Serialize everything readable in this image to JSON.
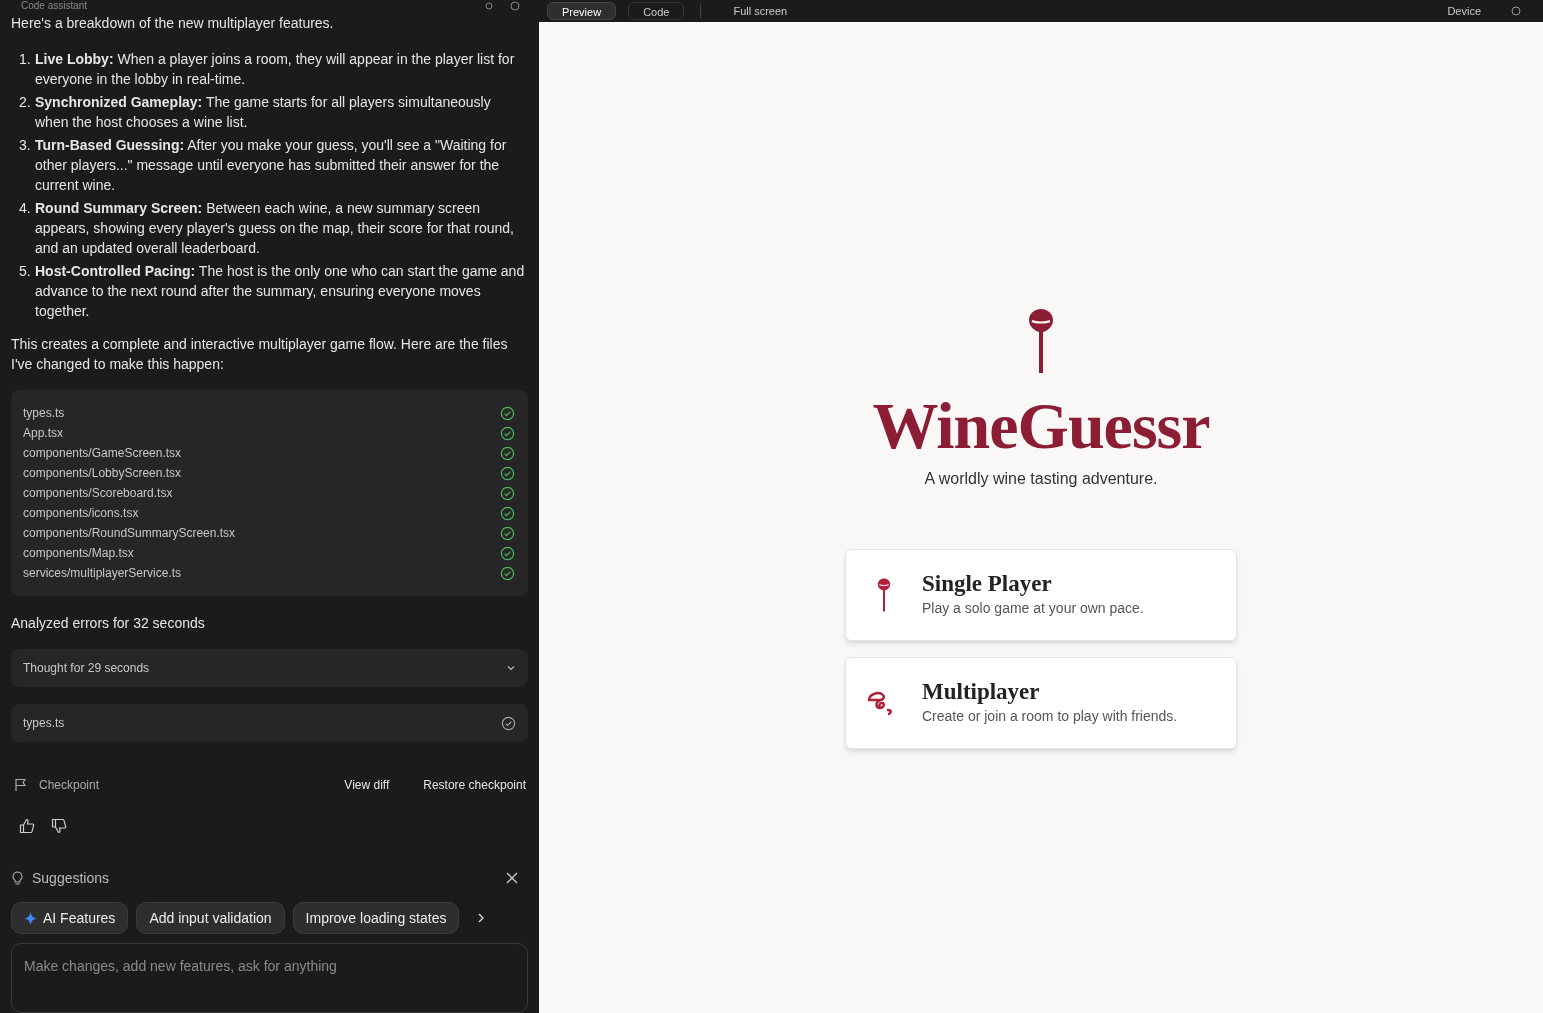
{
  "assistant": {
    "title": "Code assistant",
    "intro": "Here's a breakdown of the new multiplayer features.",
    "features": [
      {
        "number": "1.",
        "text": "**Live Lobby:** When a player joins a room, they will appear in the player list for everyone in the lobby in real-time."
      },
      {
        "number": "2.",
        "text": "**Synchronized Gameplay:** The game starts for all players simultaneously when the host chooses a wine list."
      },
      {
        "number": "3.",
        "text": "**Turn-Based Guessing:** After you make your guess, you'll see a \"Waiting for other players...\" message until everyone has submitted their answer for the current wine."
      },
      {
        "number": "4.",
        "text": "**Round Summary Screen:** Between each wine, a new summary screen appears, showing every player's guess on the map, their score for that round, and an updated overall leaderboard."
      },
      {
        "number": "5.",
        "text": "**Host-Controlled Pacing:** The host is the only one who can start the game and advance to the next round after the summary, ensuring everyone moves together."
      }
    ],
    "summary": "This creates a complete and interactive multiplayer game flow. Here are the files I've changed to make this happen:",
    "changed_files": [
      "types.ts",
      "App.tsx",
      "components/GameScreen.tsx",
      "components/LobbyScreen.tsx",
      "components/Scoreboard.tsx",
      "components/icons.tsx",
      "components/RoundSummaryScreen.tsx",
      "components/Map.tsx",
      "services/multiplayerService.ts"
    ],
    "status": "Analyzed errors for 32 seconds",
    "thought": {
      "label": "Thought for 29 seconds",
      "expanded": false
    },
    "file_step": "types.ts",
    "checkpoint": {
      "label": "Checkpoint",
      "actions": [
        "View diff",
        "Restore checkpoint"
      ]
    },
    "suggestions": {
      "title": "Suggestions",
      "chips": [
        {
          "label": "AI Features",
          "kind": "ai"
        },
        {
          "label": "Add input validation",
          "kind": "plain"
        },
        {
          "label": "Improve loading states",
          "kind": "plain"
        }
      ]
    },
    "prompt": {
      "placeholder": "Make changes, add new features, ask for anything"
    }
  },
  "preview_toolbar": {
    "tabs": [
      {
        "label": "Preview",
        "selected": true
      },
      {
        "label": "Code",
        "selected": false
      }
    ],
    "fullscreen": "Full screen",
    "device": "Device"
  },
  "app": {
    "title": "WineGuessr",
    "tagline": "A worldly wine tasting adventure.",
    "modes": [
      {
        "kind": "single",
        "title": "Single Player",
        "description": "Play a solo game at your own pace."
      },
      {
        "kind": "multi",
        "title": "Multiplayer",
        "description": "Create or join a room to play with friends."
      }
    ]
  }
}
